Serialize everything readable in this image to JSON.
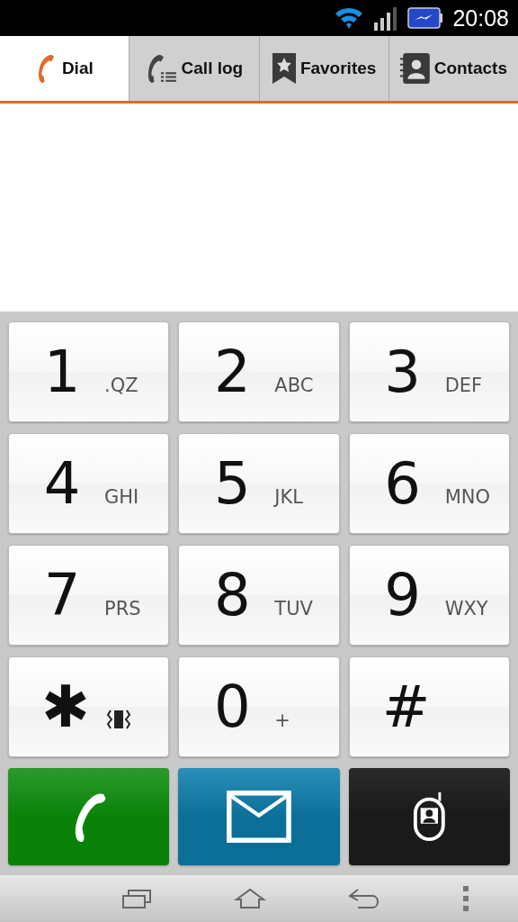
{
  "status_bar": {
    "time": "20:08"
  },
  "tabs": [
    {
      "label": "Dial",
      "kind": "phone",
      "selected": true
    },
    {
      "label": "Call log",
      "kind": "calllog",
      "selected": false
    },
    {
      "label": "Favorites",
      "kind": "star",
      "selected": false
    },
    {
      "label": "Contacts",
      "kind": "contacts",
      "selected": false
    }
  ],
  "keypad": [
    {
      "digit": "1",
      "kind": "letters",
      "sub": ".QZ"
    },
    {
      "digit": "2",
      "kind": "letters",
      "sub": "ABC"
    },
    {
      "digit": "3",
      "kind": "letters",
      "sub": "DEF"
    },
    {
      "digit": "4",
      "kind": "letters",
      "sub": "GHI"
    },
    {
      "digit": "5",
      "kind": "letters",
      "sub": "JKL"
    },
    {
      "digit": "6",
      "kind": "letters",
      "sub": "MNO"
    },
    {
      "digit": "7",
      "kind": "letters",
      "sub": "PRS"
    },
    {
      "digit": "8",
      "kind": "letters",
      "sub": "TUV"
    },
    {
      "digit": "9",
      "kind": "letters",
      "sub": "WXY"
    },
    {
      "digit": "✱",
      "kind": "vibrate"
    },
    {
      "digit": "0",
      "kind": "letters",
      "sub": "+"
    },
    {
      "digit": "#",
      "kind": "plain"
    }
  ],
  "actions": [
    {
      "kind": "call"
    },
    {
      "kind": "message"
    },
    {
      "kind": "contact"
    }
  ],
  "nav_bar": [
    {
      "kind": "recent"
    },
    {
      "kind": "home"
    },
    {
      "kind": "back"
    },
    {
      "kind": "menu"
    }
  ]
}
